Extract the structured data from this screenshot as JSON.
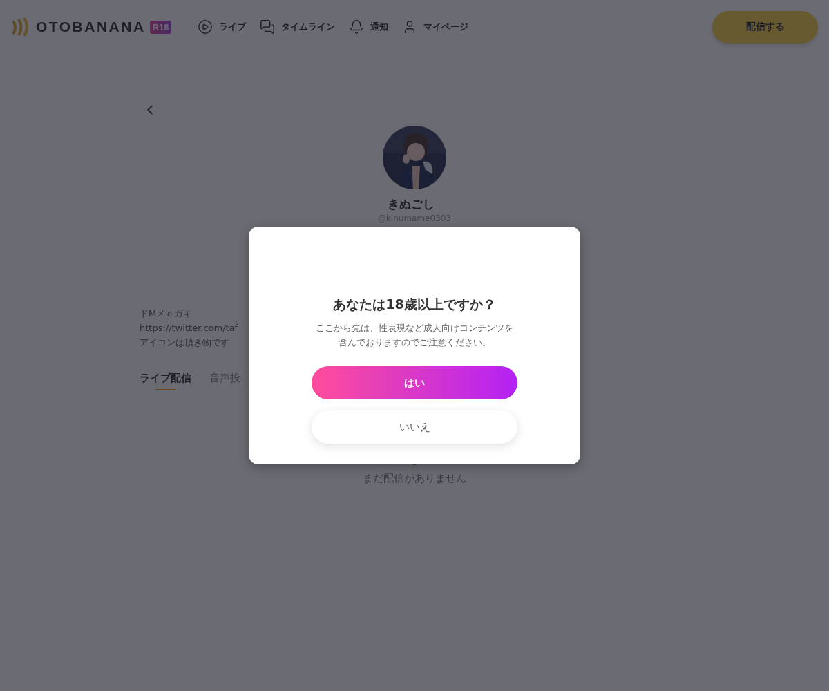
{
  "header": {
    "logo": {
      "text": "OTOBANANA",
      "badge": "R18"
    },
    "nav": [
      {
        "label": "ライブ"
      },
      {
        "label": "タイムライン"
      },
      {
        "label": "通知"
      },
      {
        "label": "マイページ"
      }
    ],
    "broadcast_button": "配信する"
  },
  "profile": {
    "name": "きぬごし",
    "handle": "@kinumame0303",
    "bio": [
      "ドMメｏガキ",
      "https://twitter.com/taf",
      "アイコンは頂き物です"
    ],
    "tabs": [
      {
        "label": "ライブ配信",
        "selected": true
      },
      {
        "label": "音声投",
        "selected": false
      }
    ],
    "empty_message": "まだ配信がありません"
  },
  "dialog": {
    "title": "あなたは18歳以上ですか？",
    "message": [
      "ここから先は、性表現など成人向けコンテンツを",
      "含んでおりますのでご注意ください。"
    ],
    "confirm": "はい",
    "cancel": "いいえ"
  }
}
